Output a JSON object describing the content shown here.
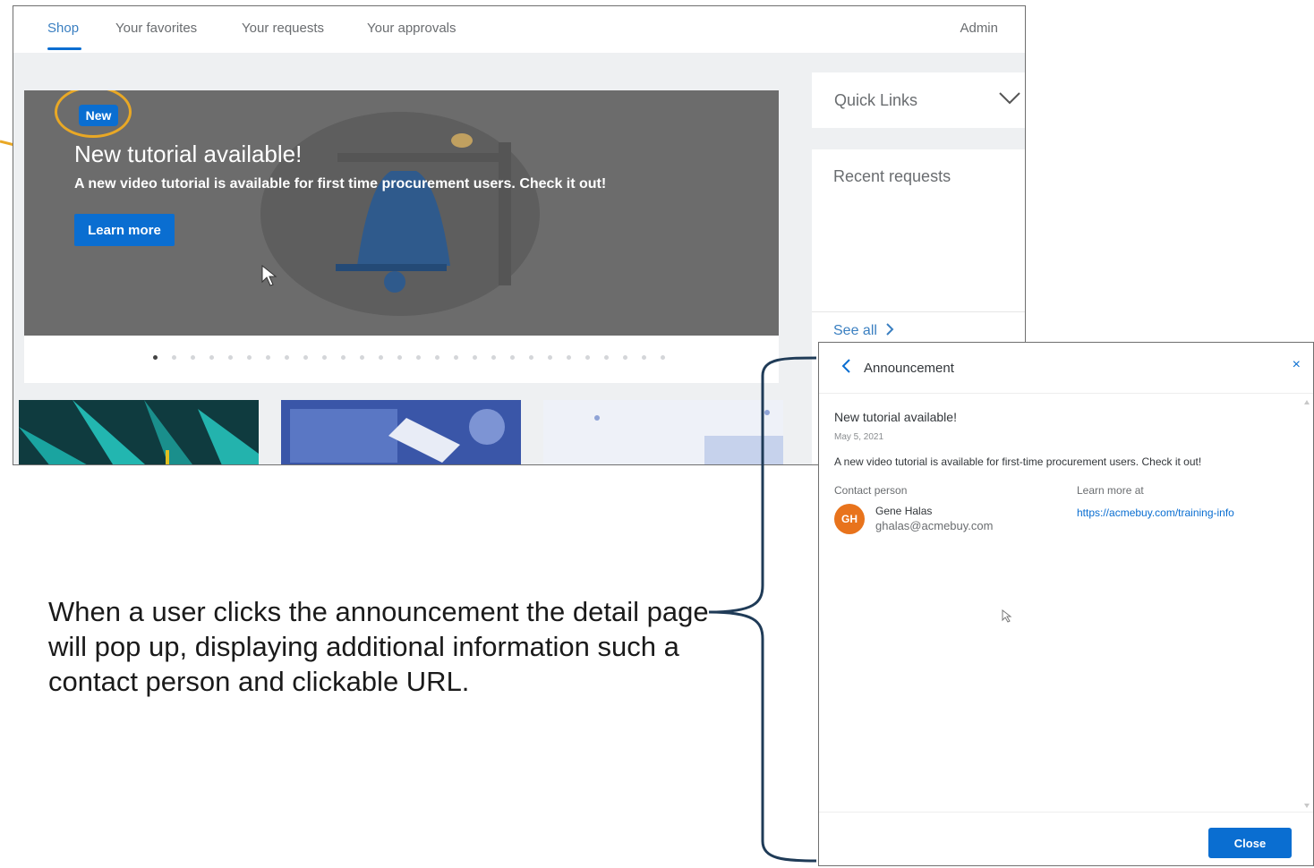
{
  "nav": {
    "tabs": [
      {
        "label": "Shop"
      },
      {
        "label": "Your favorites"
      },
      {
        "label": "Your requests"
      },
      {
        "label": "Your approvals"
      }
    ],
    "admin_label": "Admin"
  },
  "banner": {
    "badge": "New",
    "title": "New tutorial available!",
    "subtitle": "A new video tutorial is available for first time procurement users. Check it out!",
    "button_label": "Learn more",
    "carousel_dot_count": 28,
    "carousel_active_index": 0
  },
  "sidebar": {
    "quick_links_label": "Quick Links",
    "recent_requests_label": "Recent requests",
    "see_all_label": "See all"
  },
  "caption": "When a user clicks the announcement the detail page will pop up, displaying additional information such a contact person and clickable URL.",
  "dialog": {
    "header_title": "Announcement",
    "close_icon": "×",
    "title": "New tutorial available!",
    "date": "May 5, 2021",
    "body": "A new video tutorial is available for first-time procurement users. Check it out!",
    "contact_label": "Contact person",
    "contact_initials": "GH",
    "contact_name": "Gene Halas",
    "contact_email": "ghalas@acmebuy.com",
    "learn_more_label": "Learn more at",
    "learn_more_url": "https://acmebuy.com/training-info",
    "close_button": "Close"
  },
  "colors": {
    "accent": "#0a6ed1",
    "highlight": "#e9a825",
    "avatar": "#e8731c",
    "banner_bg": "#6c6c6c"
  },
  "icons": [
    "left-pointing-arrow-icon",
    "cursor-icon",
    "chevron-down-icon",
    "chevron-right-icon",
    "back-chevron-icon",
    "close-icon"
  ]
}
